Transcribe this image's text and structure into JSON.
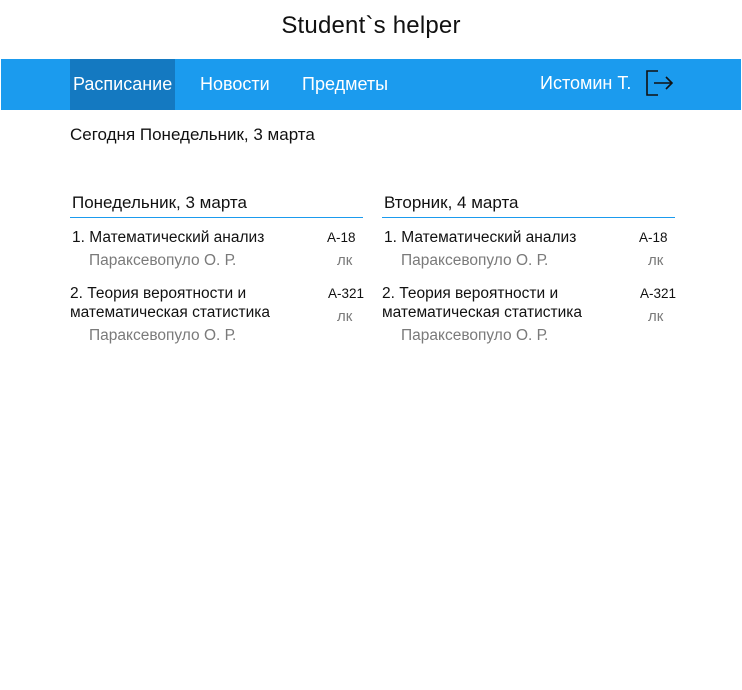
{
  "app_title": "Student`s helper",
  "navbar": {
    "items": [
      {
        "label": "Расписание",
        "active": true
      },
      {
        "label": "Новости",
        "active": false
      },
      {
        "label": "Предметы",
        "active": false
      }
    ],
    "user": "Истомин Т.",
    "logout_icon": "logout-icon"
  },
  "today_text": "Сегодня Понедельник, 3 марта",
  "days": [
    {
      "header": "Понедельник, 3 марта",
      "lessons": [
        {
          "title": "1. Математический анализ",
          "teacher": "Параксевопуло О. Р.",
          "room": "A-18",
          "type": "лк"
        },
        {
          "title": "2. Теория вероятности и математическая статистика",
          "teacher": "Параксевопуло О. Р.",
          "room": "A-321",
          "type": "лк"
        }
      ]
    },
    {
      "header": "Вторник, 4 марта",
      "lessons": [
        {
          "title": "1. Математический анализ",
          "teacher": "Параксевопуло О. Р.",
          "room": "A-18",
          "type": "лк"
        },
        {
          "title": "2. Теория вероятности и математическая статистика",
          "teacher": "Параксевопуло О. Р.",
          "room": "A-321",
          "type": "лк"
        }
      ]
    }
  ],
  "colors": {
    "navbar": "#1b9bee",
    "navbar_active": "#1479c1",
    "accent_line": "#1b9bee"
  }
}
